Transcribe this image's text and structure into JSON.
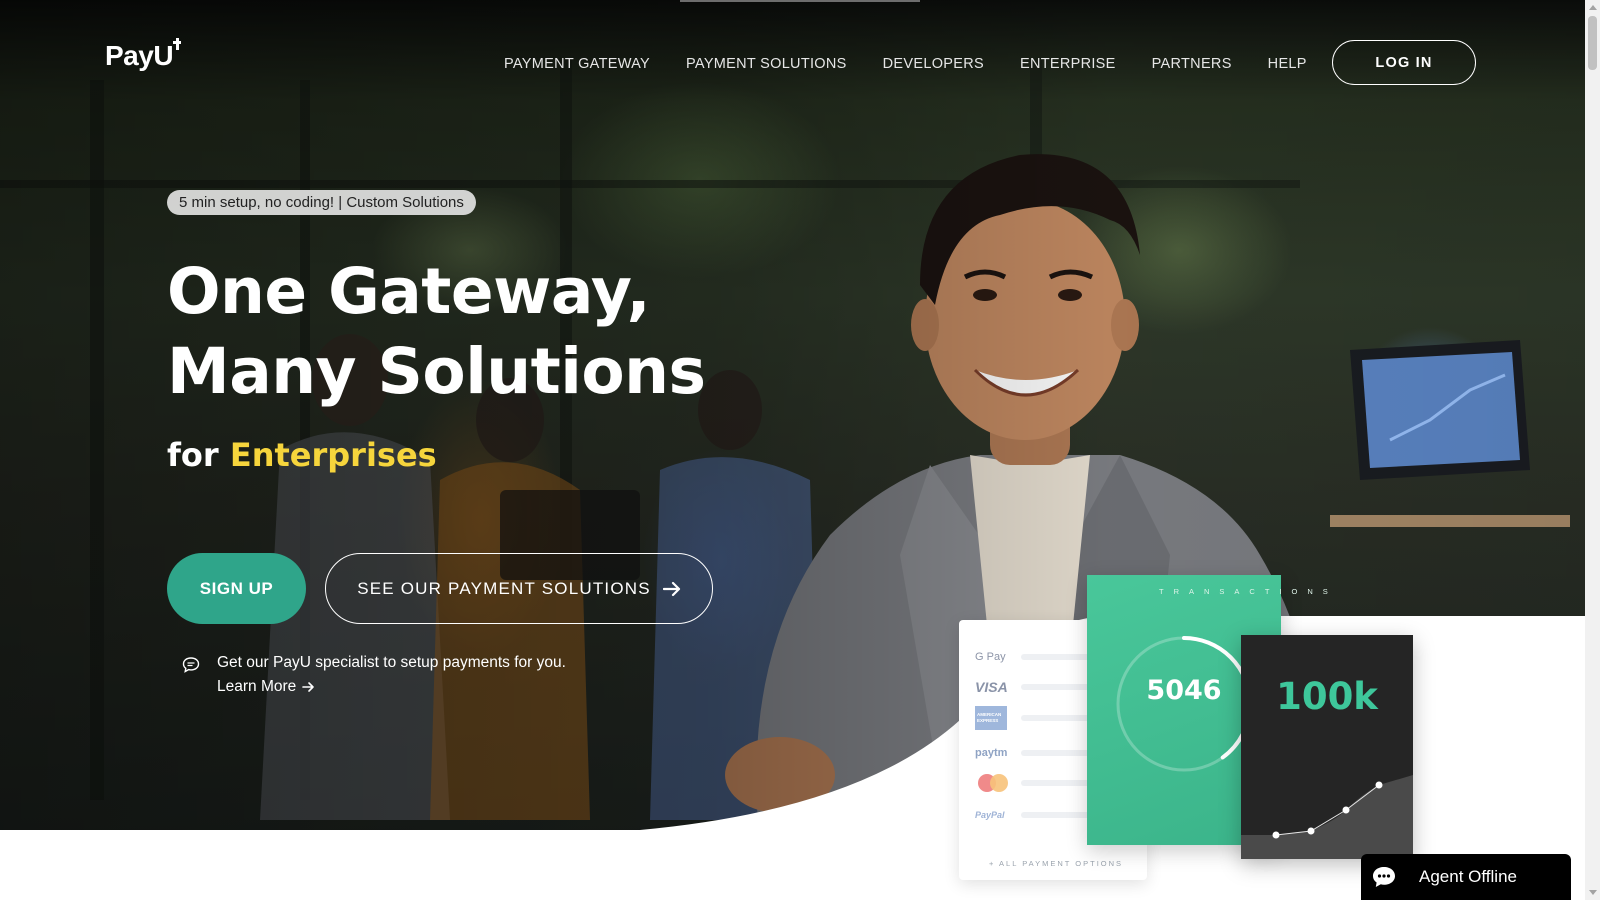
{
  "nav": {
    "brand": "PayU",
    "items": [
      {
        "label": "PAYMENT GATEWAY"
      },
      {
        "label": "PAYMENT SOLUTIONS"
      },
      {
        "label": "DEVELOPERS"
      },
      {
        "label": "ENTERPRISE"
      },
      {
        "label": "PARTNERS"
      },
      {
        "label": "HELP"
      }
    ],
    "login_label": "LOG IN"
  },
  "hero": {
    "pill": "5 min setup, no coding! | Custom Solutions",
    "headline_line1": "One Gateway,",
    "headline_line2": "Many Solutions",
    "sub_prefix": "for",
    "sub_accent": "Enterprises",
    "signup_label": "SIGN UP",
    "solutions_label": "SEE OUR PAYMENT SOLUTIONS",
    "specialist_text": "Get our PayU specialist to setup payments for you.",
    "learn_more": "Learn More",
    "accent_color": "#f6d53c",
    "brand_green": "#2fa58a"
  },
  "payment_options": {
    "logos": [
      "G Pay",
      "VISA",
      "AMERICAN EXPRESS",
      "paytm",
      "mastercard",
      "PayPal"
    ],
    "footer": "+ ALL PAYMENT OPTIONS"
  },
  "transactions_card": {
    "label": "TRANSACTIONS",
    "value": "5046",
    "ring_progress": 0.4
  },
  "growth_card": {
    "value": "100k"
  },
  "chat": {
    "status": "Agent Offline"
  }
}
